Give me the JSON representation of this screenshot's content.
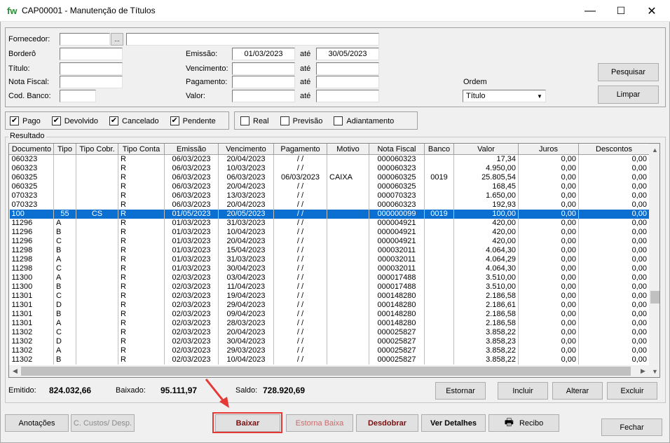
{
  "window": {
    "logo": "fw",
    "title": "CAP00001 - Manutenção de Títulos",
    "min": "—",
    "max": "☐",
    "close": "✕"
  },
  "filters": {
    "fornecedor_label": "Fornecedor:",
    "fornecedor_code": "",
    "fornecedor_btn": "...",
    "fornecedor_name": "",
    "bordero_label": "Borderô",
    "bordero_value": "",
    "titulo_label": "Título:",
    "titulo_value": "",
    "nota_label": "Nota Fiscal:",
    "nota_value": "",
    "banco_label": "Cod. Banco:",
    "banco_value": "",
    "emissao_label": "Emissão:",
    "emissao_from": "01/03/2023",
    "emissao_ate": "até",
    "emissao_to": "30/05/2023",
    "venc_label": "Vencimento:",
    "venc_from": "",
    "venc_ate": "até",
    "venc_to": "",
    "pag_label": "Pagamento:",
    "pag_from": "",
    "pag_ate": "até",
    "pag_to": "",
    "valor_label": "Valor:",
    "valor_from": "",
    "valor_ate": "até",
    "valor_to": "",
    "ordem_label": "Ordem",
    "ordem_value": "Título",
    "pesquisar": "Pesquisar",
    "limpar": "Limpar"
  },
  "status_checks": [
    {
      "label": "Pago",
      "checked": true
    },
    {
      "label": "Devolvido",
      "checked": true
    },
    {
      "label": "Cancelado",
      "checked": true
    },
    {
      "label": "Pendente",
      "checked": true
    }
  ],
  "type_checks": [
    {
      "label": "Real",
      "checked": false
    },
    {
      "label": "Previsão",
      "checked": false
    },
    {
      "label": "Adiantamento",
      "checked": false
    }
  ],
  "result_label": "Resultado",
  "columns": [
    "Documento",
    "Tipo",
    "Tipo Cobr.",
    "Tipo Conta",
    "Emissão",
    "Vencimento",
    "Pagamento",
    "Motivo",
    "Nota Fiscal",
    "Banco",
    "Valor",
    "Juros",
    "Descontos"
  ],
  "rows": [
    [
      "060323",
      "",
      "",
      "R",
      "06/03/2023",
      "20/04/2023",
      "/ /",
      "",
      "000060323",
      "",
      "17,34",
      "0,00",
      "0,00"
    ],
    [
      "060323",
      "",
      "",
      "R",
      "06/03/2023",
      "10/03/2023",
      "/ /",
      "",
      "000060323",
      "",
      "4.950,00",
      "0,00",
      "0,00"
    ],
    [
      "060325",
      "",
      "",
      "R",
      "06/03/2023",
      "06/03/2023",
      "06/03/2023",
      "CAIXA",
      "000060325",
      "0019",
      "25.805,54",
      "0,00",
      "0,00"
    ],
    [
      "060325",
      "",
      "",
      "R",
      "06/03/2023",
      "20/04/2023",
      "/ /",
      "",
      "000060325",
      "",
      "168,45",
      "0,00",
      "0,00"
    ],
    [
      "070323",
      "",
      "",
      "R",
      "06/03/2023",
      "13/03/2023",
      "/ /",
      "",
      "000070323",
      "",
      "1.650,00",
      "0,00",
      "0,00"
    ],
    [
      "070323",
      "",
      "",
      "R",
      "06/03/2023",
      "20/04/2023",
      "/ /",
      "",
      "000060323",
      "",
      "192,93",
      "0,00",
      "0,00"
    ],
    [
      "100",
      "55",
      "CS",
      "R",
      "01/05/2023",
      "20/05/2023",
      "/ /",
      "",
      "000000099",
      "0019",
      "100,00",
      "0,00",
      "0,00"
    ],
    [
      "11296",
      "A",
      "",
      "R",
      "01/03/2023",
      "31/03/2023",
      "/ /",
      "",
      "000004921",
      "",
      "420,00",
      "0,00",
      "0,00"
    ],
    [
      "11296",
      "B",
      "",
      "R",
      "01/03/2023",
      "10/04/2023",
      "/ /",
      "",
      "000004921",
      "",
      "420,00",
      "0,00",
      "0,00"
    ],
    [
      "11296",
      "C",
      "",
      "R",
      "01/03/2023",
      "20/04/2023",
      "/ /",
      "",
      "000004921",
      "",
      "420,00",
      "0,00",
      "0,00"
    ],
    [
      "11298",
      "B",
      "",
      "R",
      "01/03/2023",
      "15/04/2023",
      "/ /",
      "",
      "000032011",
      "",
      "4.064,30",
      "0,00",
      "0,00"
    ],
    [
      "11298",
      "A",
      "",
      "R",
      "01/03/2023",
      "31/03/2023",
      "/ /",
      "",
      "000032011",
      "",
      "4.064,29",
      "0,00",
      "0,00"
    ],
    [
      "11298",
      "C",
      "",
      "R",
      "01/03/2023",
      "30/04/2023",
      "/ /",
      "",
      "000032011",
      "",
      "4.064,30",
      "0,00",
      "0,00"
    ],
    [
      "11300",
      "A",
      "",
      "R",
      "02/03/2023",
      "03/04/2023",
      "/ /",
      "",
      "000017488",
      "",
      "3.510,00",
      "0,00",
      "0,00"
    ],
    [
      "11300",
      "B",
      "",
      "R",
      "02/03/2023",
      "11/04/2023",
      "/ /",
      "",
      "000017488",
      "",
      "3.510,00",
      "0,00",
      "0,00"
    ],
    [
      "11301",
      "C",
      "",
      "R",
      "02/03/2023",
      "19/04/2023",
      "/ /",
      "",
      "000148280",
      "",
      "2.186,58",
      "0,00",
      "0,00"
    ],
    [
      "11301",
      "D",
      "",
      "R",
      "02/03/2023",
      "29/04/2023",
      "/ /",
      "",
      "000148280",
      "",
      "2.186,61",
      "0,00",
      "0,00"
    ],
    [
      "11301",
      "B",
      "",
      "R",
      "02/03/2023",
      "09/04/2023",
      "/ /",
      "",
      "000148280",
      "",
      "2.186,58",
      "0,00",
      "0,00"
    ],
    [
      "11301",
      "A",
      "",
      "R",
      "02/03/2023",
      "28/03/2023",
      "/ /",
      "",
      "000148280",
      "",
      "2.186,58",
      "0,00",
      "0,00"
    ],
    [
      "11302",
      "C",
      "",
      "R",
      "02/03/2023",
      "20/04/2023",
      "/ /",
      "",
      "000025827",
      "",
      "3.858,22",
      "0,00",
      "0,00"
    ],
    [
      "11302",
      "D",
      "",
      "R",
      "02/03/2023",
      "30/04/2023",
      "/ /",
      "",
      "000025827",
      "",
      "3.858,23",
      "0,00",
      "0,00"
    ],
    [
      "11302",
      "A",
      "",
      "R",
      "02/03/2023",
      "29/03/2023",
      "/ /",
      "",
      "000025827",
      "",
      "3.858,22",
      "0,00",
      "0,00"
    ],
    [
      "11302",
      "B",
      "",
      "R",
      "02/03/2023",
      "10/04/2023",
      "/ /",
      "",
      "000025827",
      "",
      "3.858,22",
      "0,00",
      "0,00"
    ]
  ],
  "selected_row": 6,
  "totals": {
    "emitido_label": "Emitido:",
    "emitido": "824.032,66",
    "baixado_label": "Baixado:",
    "baixado": "95.111,97",
    "saldo_label": "Saldo:",
    "saldo": "728.920,69"
  },
  "grid_buttons": {
    "estornar": "Estornar",
    "incluir": "Incluir",
    "alterar": "Alterar",
    "excluir": "Excluir"
  },
  "bottom_buttons": {
    "anotacoes": "Anotações",
    "centro_custos": "C. Custos/ Desp.",
    "baixar": "Baixar",
    "estorna_baixa": "Estorna Baixa",
    "desdobrar": "Desdobrar",
    "ver_detalhes": "Ver Detalhes",
    "recibo": "Recibo",
    "fechar": "Fechar"
  },
  "colors": {
    "selection": "#0a6fd0",
    "highlight": "#e53935",
    "logo": "#2e8b3a",
    "dark_red": "#7a1010"
  }
}
